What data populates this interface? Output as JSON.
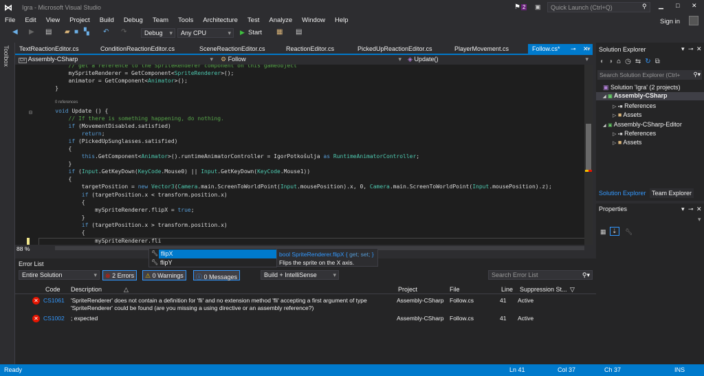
{
  "window": {
    "title": "Igra - Microsoft Visual Studio",
    "notification_count": "2",
    "quick_launch_placeholder": "Quick Launch (Ctrl+Q)",
    "sign_in": "Sign in"
  },
  "menu": [
    "File",
    "Edit",
    "View",
    "Project",
    "Build",
    "Debug",
    "Team",
    "Tools",
    "Architecture",
    "Test",
    "Analyze",
    "Window",
    "Help"
  ],
  "toolbar": {
    "config": "Debug",
    "platform": "Any CPU",
    "start": "Start"
  },
  "toolbox_label": "Toolbox",
  "tabs": [
    "TextReactionEditor.cs",
    "ConditionReactionEditor.cs",
    "SceneReactionEditor.cs",
    "ReactionEditor.cs",
    "PickedUpReactionEditor.cs",
    "PlayerMovement.cs",
    "Follow.cs*"
  ],
  "navbar": {
    "project": "Assembly-CSharp",
    "class": "Follow",
    "member": "Update()"
  },
  "code": {
    "references_label": "0 references",
    "lines": [
      [
        [
          "        // get a reference to the SpriteRenderer component on this gameobject",
          "cm"
        ]
      ],
      [
        [
          "        mySpriteRenderer = GetComponent<",
          "pl"
        ],
        [
          "SpriteRenderer",
          "ty"
        ],
        [
          ">();",
          "pl"
        ]
      ],
      [
        [
          "        animator = GetComponent<",
          "pl"
        ],
        [
          "Animator",
          "ty"
        ],
        [
          ">();",
          "pl"
        ]
      ],
      [
        [
          "    }",
          "pl"
        ]
      ],
      [],
      [],
      [
        [
          "    ",
          "pl"
        ],
        [
          "void",
          "kw"
        ],
        [
          " Update () {",
          "pl"
        ]
      ],
      [
        [
          "        // If there is something happening, do nothing.",
          "cm"
        ]
      ],
      [
        [
          "        ",
          "pl"
        ],
        [
          "if",
          "kw"
        ],
        [
          " (MovementDisabled.satisfied)",
          "pl"
        ]
      ],
      [
        [
          "            ",
          "pl"
        ],
        [
          "return",
          "kw"
        ],
        [
          ";",
          "pl"
        ]
      ],
      [
        [
          "        ",
          "pl"
        ],
        [
          "if",
          "kw"
        ],
        [
          " (PickedUpSunglasses.satisfied)",
          "pl"
        ]
      ],
      [
        [
          "        {",
          "pl"
        ]
      ],
      [
        [
          "            ",
          "pl"
        ],
        [
          "this",
          "kw"
        ],
        [
          ".GetComponent<",
          "pl"
        ],
        [
          "Animator",
          "ty"
        ],
        [
          ">().runtimeAnimatorController = IgorPotkošulja ",
          "pl"
        ],
        [
          "as",
          "kw"
        ],
        [
          " ",
          "pl"
        ],
        [
          "RuntimeAnimatorController",
          "ty"
        ],
        [
          ";",
          "pl"
        ]
      ],
      [
        [
          "        }",
          "pl"
        ]
      ],
      [
        [
          "        ",
          "pl"
        ],
        [
          "if",
          "kw"
        ],
        [
          " (",
          "pl"
        ],
        [
          "Input",
          "ty"
        ],
        [
          ".GetKeyDown(",
          "pl"
        ],
        [
          "KeyCode",
          "ty"
        ],
        [
          ".Mouse0) || ",
          "pl"
        ],
        [
          "Input",
          "ty"
        ],
        [
          ".GetKeyDown(",
          "pl"
        ],
        [
          "KeyCode",
          "ty"
        ],
        [
          ".Mouse1))",
          "pl"
        ]
      ],
      [
        [
          "        {",
          "pl"
        ]
      ],
      [
        [
          "            targetPosition = ",
          "pl"
        ],
        [
          "new",
          "kw"
        ],
        [
          " ",
          "pl"
        ],
        [
          "Vector3",
          "ty"
        ],
        [
          "(",
          "pl"
        ],
        [
          "Camera",
          "ty"
        ],
        [
          ".main.ScreenToWorldPoint(",
          "pl"
        ],
        [
          "Input",
          "ty"
        ],
        [
          ".mousePosition).x, 0, ",
          "pl"
        ],
        [
          "Camera",
          "ty"
        ],
        [
          ".main.ScreenToWorldPoint(",
          "pl"
        ],
        [
          "Input",
          "ty"
        ],
        [
          ".mousePosition).z);",
          "pl"
        ]
      ],
      [
        [
          "            ",
          "pl"
        ],
        [
          "if",
          "kw"
        ],
        [
          " (targetPosition.x < transform.position.x)",
          "pl"
        ]
      ],
      [
        [
          "            {",
          "pl"
        ]
      ],
      [
        [
          "                mySpriteRenderer.flipX = ",
          "pl"
        ],
        [
          "true",
          "kw"
        ],
        [
          ";",
          "pl"
        ]
      ],
      [
        [
          "            }",
          "pl"
        ]
      ],
      [
        [
          "            ",
          "pl"
        ],
        [
          "if",
          "kw"
        ],
        [
          " (targetPosition.x > transform.position.x)",
          "pl"
        ]
      ],
      [
        [
          "            {",
          "pl"
        ]
      ],
      [
        [
          "                mySpriteRenderer.fli",
          "pl"
        ]
      ]
    ]
  },
  "editor": {
    "zoom": "88 %"
  },
  "completion": {
    "items": [
      "flipX",
      "flipY"
    ],
    "tooltip_signature_pre": "bool SpriteRenderer.flipX { ",
    "tooltip_get": "get;",
    "tooltip_set": "set;",
    "tooltip_signature_post": " }",
    "tooltip_desc": "Flips the sprite on the X axis."
  },
  "error_list": {
    "title": "Error List",
    "scope": "Entire Solution",
    "errors": "2 Errors",
    "warnings": "0 Warnings",
    "messages": "0 Messages",
    "source": "Build + IntelliSense",
    "search_placeholder": "Search Error List",
    "columns": [
      "Code",
      "Description",
      "Project",
      "File",
      "Line",
      "Suppression St..."
    ],
    "rows": [
      {
        "code": "CS1061",
        "description": "'SpriteRenderer' does not contain a definition for 'fli' and no extension method 'fli' accepting a first argument of type",
        "description2": "'SpriteRenderer' could be found (are you missing a using directive or an assembly reference?)",
        "project": "Assembly-CSharp",
        "file": "Follow.cs",
        "line": "41",
        "suppression": "Active"
      },
      {
        "code": "CS1002",
        "description": "; expected",
        "description2": "",
        "project": "Assembly-CSharp",
        "file": "Follow.cs",
        "line": "41",
        "suppression": "Active"
      }
    ]
  },
  "solution_explorer": {
    "title": "Solution Explorer",
    "search_placeholder": "Search Solution Explorer (Ctrl+",
    "solution": "Solution 'Igra' (2 projects)",
    "project1": "Assembly-CSharp",
    "project2": "Assembly-CSharp-Editor",
    "references": "References",
    "assets": "Assets",
    "tab_solution": "Solution Explorer",
    "tab_team": "Team Explorer"
  },
  "properties": {
    "title": "Properties"
  },
  "status": {
    "state": "Ready",
    "ln": "Ln 41",
    "col": "Col 37",
    "ch": "Ch 37",
    "mode": "INS"
  },
  "colors": {
    "accent": "#007acc",
    "background": "#2d2d30",
    "editor": "#1e1e1e",
    "error": "#e51400"
  }
}
